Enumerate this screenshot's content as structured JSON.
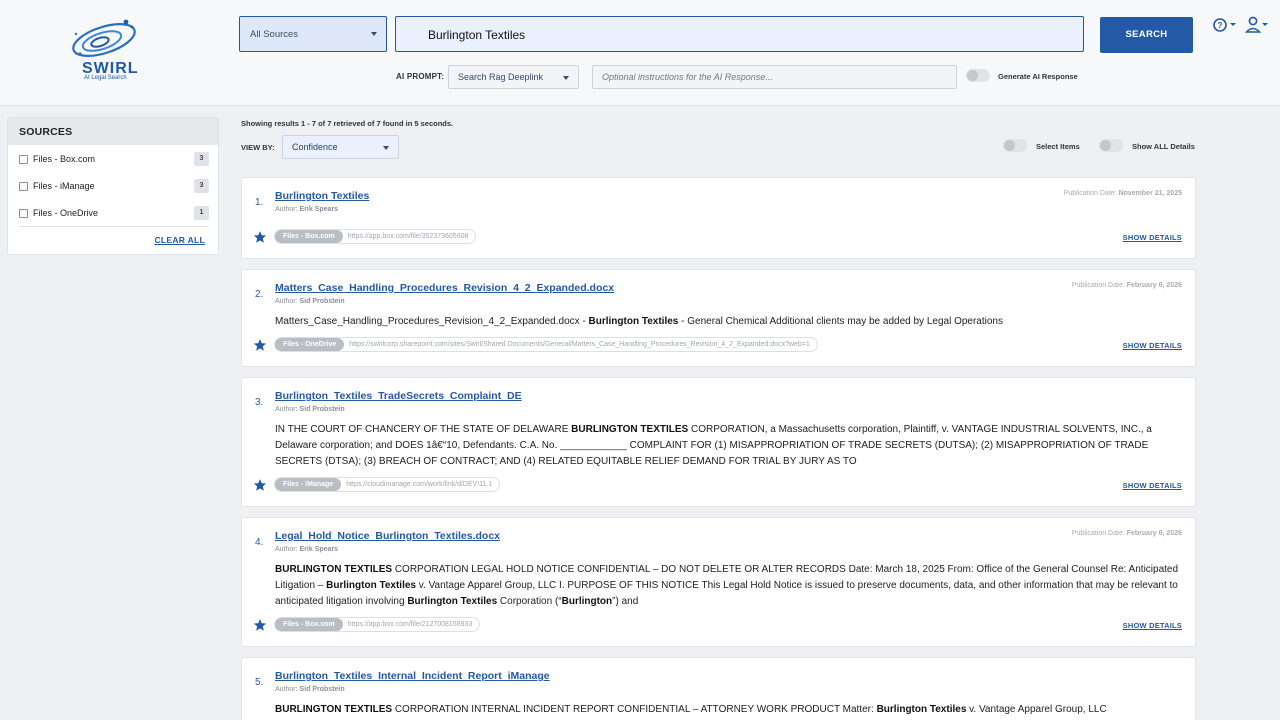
{
  "brand": {
    "name": "SWIRL",
    "tagline": "AI Legal Search"
  },
  "search": {
    "source_selected": "All Sources",
    "query": "Burlington Textiles",
    "button_label": "SEARCH"
  },
  "ai": {
    "label": "AI PROMPT:",
    "mode_selected": "Search Rag Deeplink",
    "instructions_placeholder": "Optional instructions for the AI Response...",
    "generate_label": "Generate AI Response"
  },
  "sidebar": {
    "title": "SOURCES",
    "items": [
      {
        "label": "Files - Box.com",
        "count": "3"
      },
      {
        "label": "Files - iManage",
        "count": "3"
      },
      {
        "label": "Files - OneDrive",
        "count": "1"
      }
    ],
    "clear_label": "CLEAR ALL"
  },
  "results_header": {
    "summary": "Showing results 1 - 7 of 7 retrieved of 7 found in 5 seconds.",
    "viewby_label": "VIEW BY:",
    "viewby_selected": "Confidence",
    "select_items_label": "Select Items",
    "show_all_label": "Show ALL Details"
  },
  "results": [
    {
      "num": "1.",
      "title": "Burlington Textiles",
      "author_prefix": "Author:",
      "author": "Erik Spears",
      "date_prefix": "Publication Date:",
      "date": "November 21, 2025",
      "source": "Files - Box.com",
      "url": "https://app.box.com/file/352373605608",
      "details_label": "SHOW DETAILS"
    },
    {
      "num": "2.",
      "title": "Matters_Case_Handling_Procedures_Revision_4_2_Expanded.docx",
      "author_prefix": "Author:",
      "author": "Sid Probstein",
      "date_prefix": "Publication Date:",
      "date": "February 6, 2026",
      "snippet_a": "Matters_Case_Handling_Procedures_Revision_4_2_Expanded.docx - ",
      "snippet_b": "Burlington Textiles",
      "snippet_c": " - General Chemical Additional clients may be added by Legal Operations",
      "source": "Files - OneDrive",
      "url": "https://swirlcorp.sharepoint.com/sites/Swirl/Shared Documents/General/Matters_Case_Handling_Procedures_Revision_4_2_Expanded.docx?web=1",
      "details_label": "SHOW DETAILS"
    },
    {
      "num": "3.",
      "title": "Burlington_Textiles_TradeSecrets_Complaint_DE",
      "author_prefix": "Author:",
      "author": "Sid Probstein",
      "snippet_a": "IN THE COURT OF CHANCERY OF THE STATE OF DELAWARE ",
      "snippet_b": "BURLINGTON TEXTILES",
      "snippet_c": " CORPORATION, a Massachusetts corporation, Plaintiff, v. VANTAGE INDUSTRIAL SOLVENTS, INC., a Delaware corporation; and DOES 1â€“10, Defendants. C.A. No. ____________ COMPLAINT FOR (1) MISAPPROPRIATION OF TRADE SECRETS (DUTSA); (2) MISAPPROPRIATION OF TRADE SECRETS (DTSA); (3) BREACH OF CONTRACT; AND (4) RELATED EQUITABLE RELIEF DEMAND FOR TRIAL BY JURY AS TO",
      "source": "Files - iManage",
      "url": "https://cloudimanage.com/work/link/d/DEV!11.1",
      "details_label": "SHOW DETAILS"
    },
    {
      "num": "4.",
      "title": "Legal_Hold_Notice_Burlington_Textiles.docx",
      "author_prefix": "Author:",
      "author": "Erik Spears",
      "date_prefix": "Publication Date:",
      "date": "February 6, 2026",
      "snippet_a": "BURLINGTON TEXTILES",
      "snippet_b": " CORPORATION LEGAL HOLD NOTICE CONFIDENTIAL – DO NOT DELETE OR ALTER RECORDS Date: March 18, 2025 From: Office of the General Counsel Re: Anticipated Litigation – ",
      "snippet_c": "Burlington Textiles",
      "snippet_d": " v. Vantage Apparel Group, LLC I. PURPOSE OF THIS NOTICE This Legal Hold Notice is issued to preserve documents, data, and other information that may be relevant to anticipated litigation involving ",
      "snippet_e": "Burlington Textiles",
      "snippet_f": " Corporation (“",
      "snippet_g": "Burlington",
      "snippet_h": "”) and",
      "source": "Files - Box.com",
      "url": "https://app.box.com/file/2127008158933",
      "details_label": "SHOW DETAILS"
    },
    {
      "num": "5.",
      "title": "Burlington_Textiles_Internal_Incident_Report_iManage",
      "author_prefix": "Author:",
      "author": "Sid Probstein",
      "snippet_a": "BURLINGTON TEXTILES",
      "snippet_b": " CORPORATION INTERNAL INCIDENT REPORT CONFIDENTIAL – ATTORNEY WORK PRODUCT Matter: ",
      "snippet_c": "Burlington Textiles",
      "snippet_d": " v. Vantage Apparel Group, LLC"
    }
  ],
  "colors": {
    "accent": "#2459a6",
    "header_bg": "#f7f8fa",
    "page_bg": "#eef0f3"
  },
  "icons": [
    "swirl-logo",
    "help-icon",
    "user-icon",
    "star-icon",
    "chevron-down-icon"
  ]
}
